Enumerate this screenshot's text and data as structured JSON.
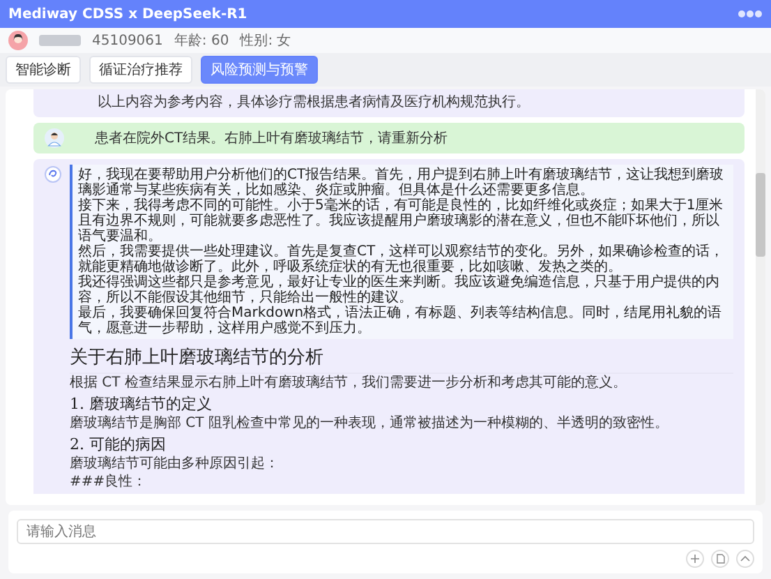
{
  "window": {
    "title": "Mediway CDSS x DeepSeek-R1"
  },
  "patient": {
    "id": "45109061",
    "age": "年龄: 60",
    "sex": "性别: 女"
  },
  "tabs": [
    {
      "label": "智能诊断",
      "selected": false
    },
    {
      "label": "循证治疗推荐",
      "selected": false
    },
    {
      "label": "风险预测与预警",
      "selected": true
    }
  ],
  "messages": [
    {
      "kind": "tail",
      "text": "以上内容为参考内容，具体诊疗需根据患者病情及医疗机构规范执行。"
    },
    {
      "kind": "user",
      "text": "患者在院外CT结果。右肺上叶有磨玻璃结节，请重新分析"
    },
    {
      "kind": "assistant",
      "thinking": [
        "好，我现在要帮助用户分析他们的CT报告结果。首先，用户提到右肺上叶有磨玻璃结节，这让我想到磨玻璃影通常与某些疾病有关，比如感染、炎症或肿瘤。但具体是什么还需要更多信息。",
        "接下来，我得考虑不同的可能性。小于5毫米的话，有可能是良性的，比如纤维化或炎症；如果大于1厘米且有边界不规则，可能就要多虑恶性了。我应该提醒用户磨玻璃影的潜在意义，但也不能吓坏他们，所以语气要温和。",
        "然后，我需要提供一些处理建议。首先是复查CT，这样可以观察结节的变化。另外，如果确诊检查的话，就能更精确地做诊断了。此外，呼吸系统症状的有无也很重要，比如咳嗽、发热之类的。",
        "我还得强调这些都只是参考意见，最好让专业的医生来判断。我应该避免编造信息，只基于用户提供的内容，所以不能假设其他细节，只能给出一般性的建议。",
        "最后，我要确保回复符合Markdown格式，语法正确，有标题、列表等结构信息。同时，结尾用礼貌的语气，愿意进一步帮助，这样用户感觉不到压力。"
      ],
      "blocks": [
        {
          "kind": "h2",
          "text": "关于右肺上叶磨玻璃结节的分析"
        },
        {
          "kind": "p",
          "text": "根据 CT 检查结果显示右肺上叶有磨玻璃结节，我们需要进一步分析和考虑其可能的意义。"
        },
        {
          "kind": "h3",
          "text": "1.  磨玻璃结节的定义"
        },
        {
          "kind": "p",
          "text": "磨玻璃结节是胸部 CT 阻乳检查中常见的一种表现，通常被描述为一种模糊的、半透明的致密性。"
        },
        {
          "kind": "h3",
          "text": "2.  可能的病因"
        },
        {
          "kind": "p",
          "text": "磨玻璃结节可能由多种原因引起："
        },
        {
          "kind": "p",
          "text": "###良性："
        }
      ]
    }
  ],
  "input": {
    "placeholder": "请输入消息"
  }
}
